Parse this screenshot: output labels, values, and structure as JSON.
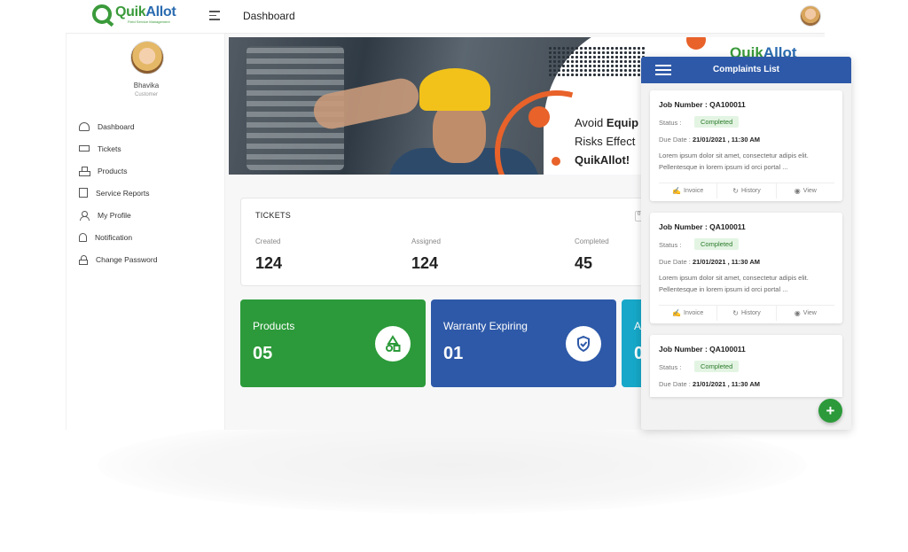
{
  "app": {
    "logo_name_a": "Quik",
    "logo_name_b": "Allot",
    "logo_sub": "Field Service Management",
    "page_title": "Dashboard"
  },
  "user": {
    "name": "Bhavika",
    "role": "Customer"
  },
  "sidebar": {
    "items": [
      {
        "label": "Dashboard",
        "icon": "dashboard-icon"
      },
      {
        "label": "Tickets",
        "icon": "ticket-icon"
      },
      {
        "label": "Products",
        "icon": "products-icon"
      },
      {
        "label": "Service Reports",
        "icon": "report-icon"
      },
      {
        "label": "My Profile",
        "icon": "profile-icon"
      },
      {
        "label": "Notification",
        "icon": "bell-icon"
      },
      {
        "label": "Change Password",
        "icon": "lock-icon"
      }
    ]
  },
  "banner": {
    "logo_a": "Quik",
    "logo_b": "Allot",
    "line1_a": "Avoid ",
    "line1_b": "Equip",
    "line2": "Risks Effect",
    "line3": "QuikAllot!"
  },
  "tickets": {
    "title": "TICKETS",
    "chip": "0",
    "stats": [
      {
        "label": "Created",
        "value": "124"
      },
      {
        "label": "Assigned",
        "value": "124"
      },
      {
        "label": "Completed",
        "value": "45"
      }
    ]
  },
  "tiles": [
    {
      "label": "Products",
      "value": "05",
      "icon": "shapes-icon",
      "color": "#2c9a3a"
    },
    {
      "label": "Warranty Expiring",
      "value": "01",
      "icon": "shield-check-icon",
      "color": "#2e59a8"
    },
    {
      "label": "A",
      "value": "0",
      "color": "#17a8c9"
    }
  ],
  "complaints": {
    "title": "Complaints List",
    "status_label": "Status :",
    "due_label": "Due Date :",
    "actions": [
      "Invoice",
      "History",
      "View"
    ],
    "jobs": [
      {
        "number": "Job Number : QA100011",
        "status": "Completed",
        "due": "21/01/2021 , 11:30 AM",
        "desc": "Lorem ipsum dolor sit amet, consectetur adipis elit. Pellentesque in lorem ipsum id orci portal ..."
      },
      {
        "number": "Job Number : QA100011",
        "status": "Completed",
        "due": "21/01/2021 , 11:30 AM",
        "desc": "Lorem ipsum dolor sit amet, consectetur adipis elit. Pellentesque in lorem ipsum id orci portal ..."
      },
      {
        "number": "Job Number : QA100011",
        "status": "Completed",
        "due": "21/01/2021 , 11:30 AM",
        "desc": ""
      }
    ],
    "fab_label": "+"
  },
  "colors": {
    "brand_blue": "#2e59a8",
    "brand_green": "#2c9a3a",
    "accent_orange": "#e8622a"
  }
}
